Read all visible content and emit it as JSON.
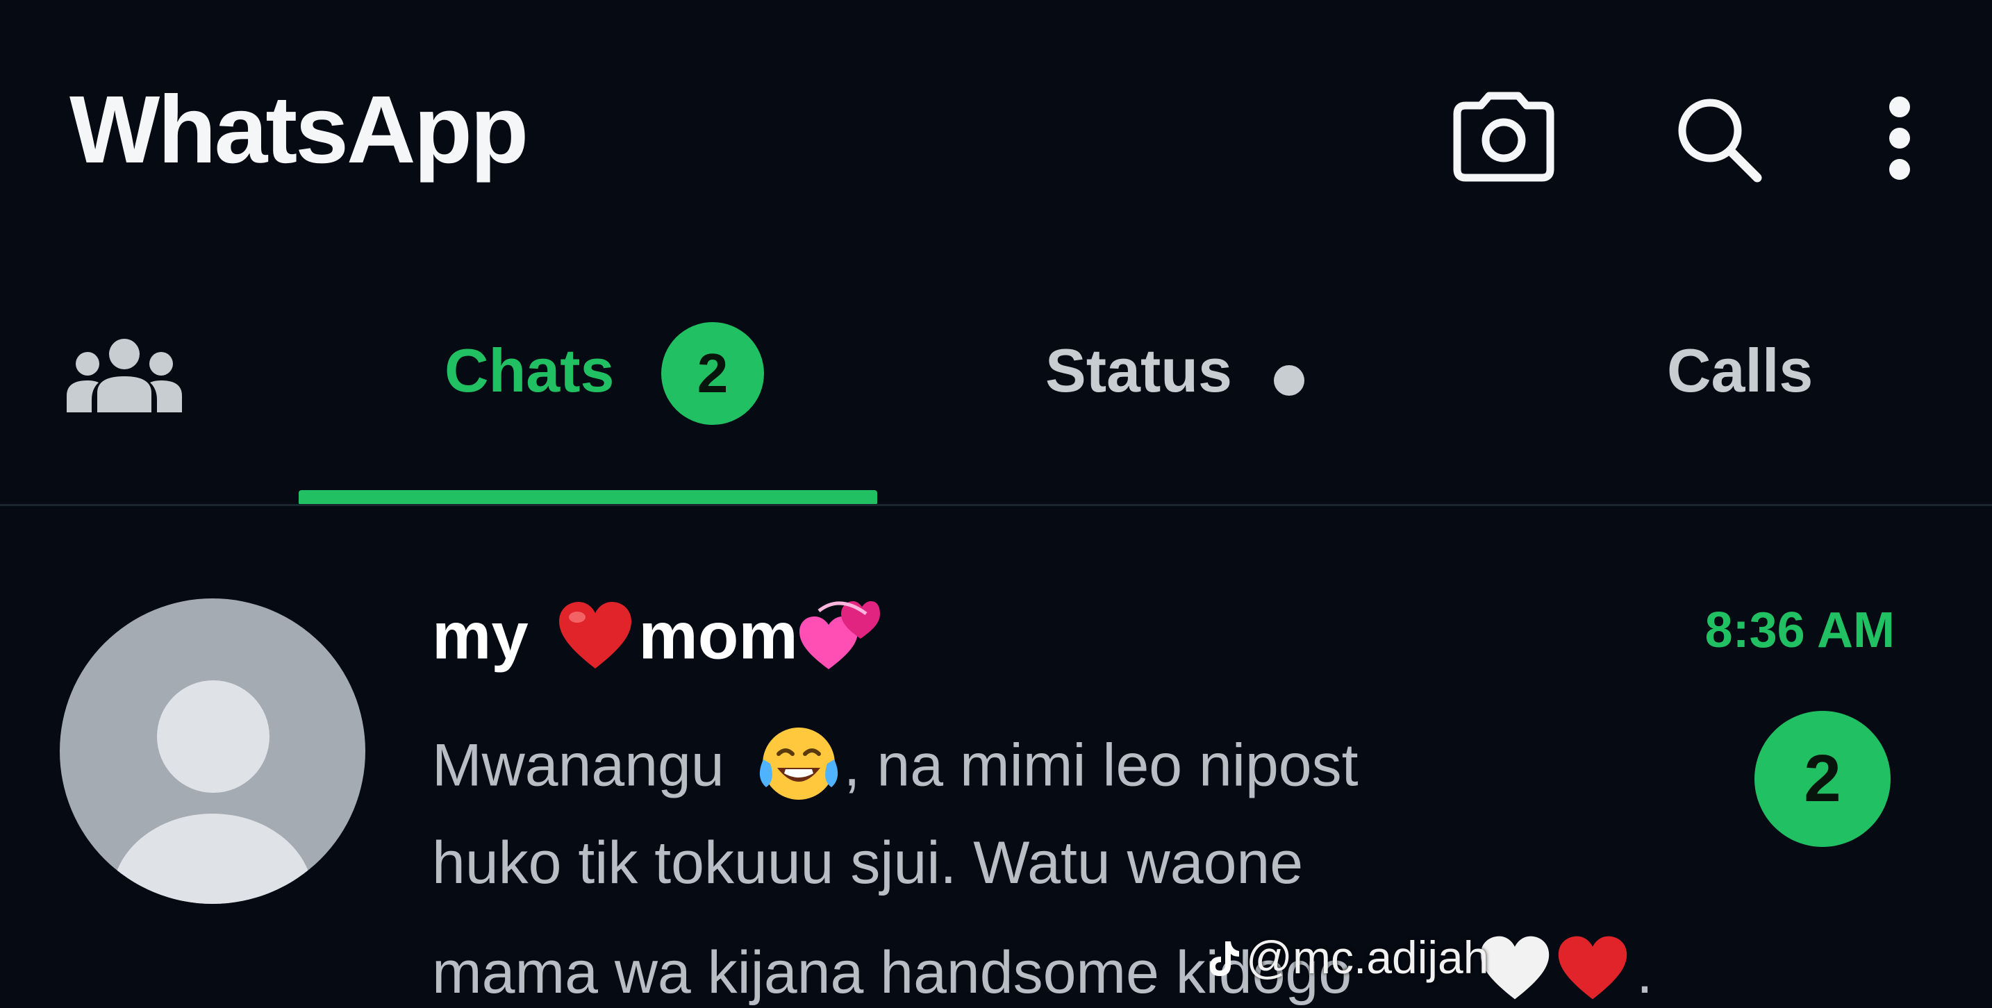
{
  "header": {
    "title": "WhatsApp",
    "icons": [
      "camera-icon",
      "search-icon",
      "more-vert-icon"
    ]
  },
  "tabs": {
    "community_icon": "community-icon",
    "chats": {
      "label": "Chats",
      "badge": "2"
    },
    "status": {
      "label": "Status"
    },
    "calls": {
      "label": "Calls"
    }
  },
  "chat": {
    "name": "my",
    "name_suffix": "mom",
    "time": "8:36 AM",
    "unread": "2",
    "preview": {
      "line1_a": "Mwanangu",
      "line1_b": ", na mimi leo nipost",
      "line2": "huko tik tokuuu sjui. Watu waone",
      "line3": "mama wa kijana handsome kidogo",
      "line3_end": "."
    }
  },
  "watermark": {
    "handle": "@mc.adijah"
  },
  "colors": {
    "accent": "#21c063",
    "background": "#050a13"
  }
}
